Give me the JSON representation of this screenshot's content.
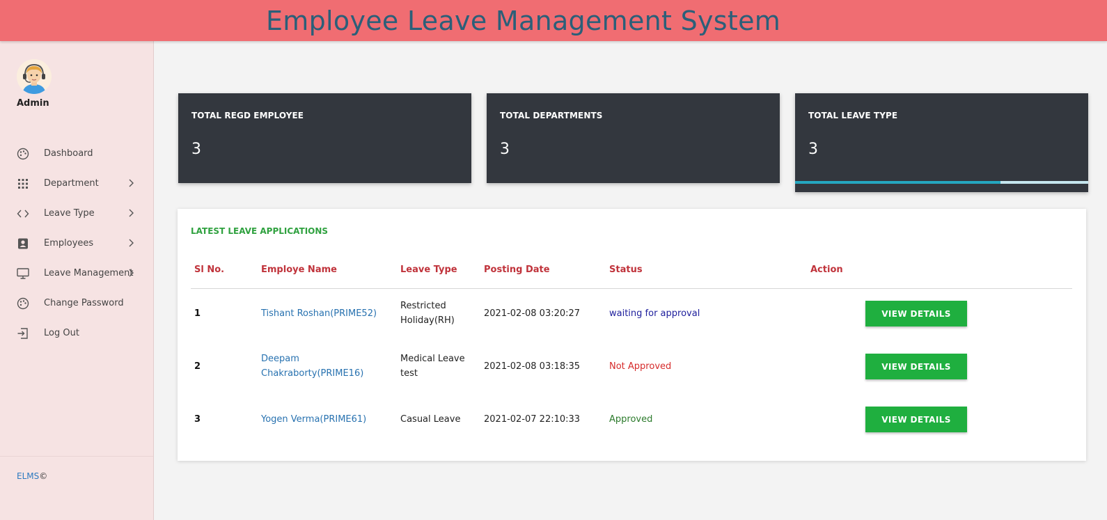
{
  "header": {
    "title": "Employee Leave Management System"
  },
  "sidebar": {
    "user": "Admin",
    "items": [
      {
        "label": "Dashboard",
        "icon": "dashboard-icon",
        "chevron": false
      },
      {
        "label": "Department",
        "icon": "grid-icon",
        "chevron": true
      },
      {
        "label": "Leave Type",
        "icon": "code-icon",
        "chevron": true
      },
      {
        "label": "Employees",
        "icon": "contact-card-icon",
        "chevron": true
      },
      {
        "label": "Leave Management",
        "icon": "monitor-icon",
        "chevron": true
      },
      {
        "label": "Change Password",
        "icon": "palette-icon",
        "chevron": false
      },
      {
        "label": "Log Out",
        "icon": "logout-icon",
        "chevron": false
      }
    ],
    "footer": {
      "brand": "ELMS",
      "symbol": "©"
    }
  },
  "stats": [
    {
      "title": "TOTAL REGD EMPLOYEE",
      "value": "3"
    },
    {
      "title": "TOTAL DEPARTMENTS",
      "value": "3"
    },
    {
      "title": "TOTAL LEAVE TYPE",
      "value": "3",
      "progress": 0.7
    }
  ],
  "latest": {
    "title": "LATEST LEAVE APPLICATIONS",
    "columns": [
      "Sl No.",
      "Employe Name",
      "Leave Type",
      "Posting Date",
      "Status",
      "Action"
    ],
    "rows": [
      {
        "sl": "1",
        "name_line1": "Tishant Roshan(PRIME52)",
        "name_line2": "",
        "type_line1": "Restricted",
        "type_line2": "Holiday(RH)",
        "date": "2021-02-08 03:20:27",
        "status": "waiting for approval",
        "status_kind": "waiting",
        "action": "VIEW DETAILS"
      },
      {
        "sl": "2",
        "name_line1": "Deepam",
        "name_line2": "Chakraborty(PRIME16)",
        "type_line1": "Medical Leave",
        "type_line2": "test",
        "date": "2021-02-08 03:18:35",
        "status": "Not Approved",
        "status_kind": "rejected",
        "action": "VIEW DETAILS"
      },
      {
        "sl": "3",
        "name_line1": "Yogen Verma(PRIME61)",
        "name_line2": "",
        "type_line1": "Casual Leave",
        "type_line2": "",
        "date": "2021-02-07 22:10:33",
        "status": "Approved",
        "status_kind": "approved",
        "action": "VIEW DETAILS"
      }
    ]
  },
  "colors": {
    "topbar": "#f06d72",
    "title": "#2b5f79",
    "sidebar": "#f6e3e3",
    "card": "#33373e",
    "section_title": "#2fa13f",
    "column_header": "#c0333b",
    "button": "#1faf3f",
    "progress": "#25a7c0"
  }
}
